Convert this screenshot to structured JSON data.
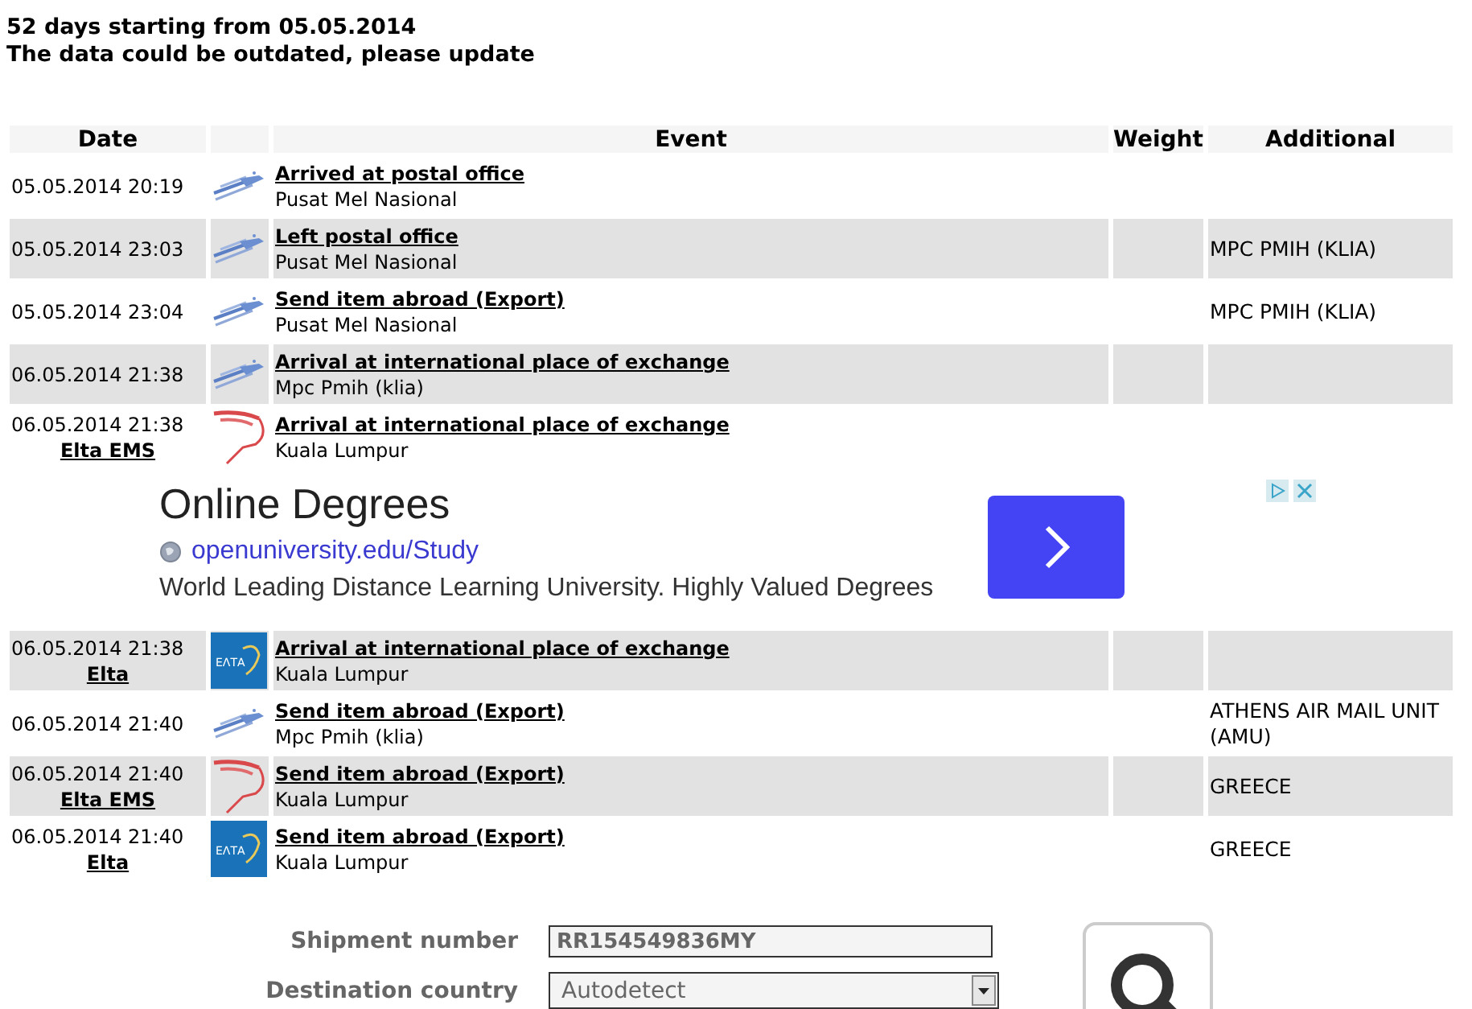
{
  "header": {
    "lines": [
      "52 days starting from 05.05.2014",
      "The data could be outdated, please update"
    ]
  },
  "table": {
    "columns": [
      {
        "label": "Date"
      },
      {
        "label": "Event"
      },
      {
        "label": "Weight"
      },
      {
        "label": "Additional"
      }
    ],
    "rows": [
      {
        "kind": "post_event",
        "date": "05.05.2014 20:19",
        "event": "Arrived at postal office",
        "place": "Pusat Mel Nasional"
      },
      {
        "kind": "post_event",
        "date": "05.05.2014 23:03",
        "event": "Left postal office",
        "place": "Pusat Mel Nasional",
        "additional": "MPC PMIH (KLIA)"
      },
      {
        "kind": "post_event",
        "date": "05.05.2014 23:04",
        "event": "Send item abroad (Export)",
        "place": "Pusat Mel Nasional",
        "additional": "MPC PMIH (KLIA)"
      },
      {
        "kind": "post_event",
        "date": "06.05.2014 21:38",
        "event": "Arrival at international place of exchange",
        "place": "Mpc Pmih (klia)"
      },
      {
        "kind": "ems_event",
        "date": "06.05.2014 21:38",
        "carrier": "Elta EMS",
        "event": "Arrival at international place of exchange",
        "place": "Kuala Lumpur"
      },
      {
        "kind": "ad",
        "title": "Online Degrees",
        "url": "openuniversity.edu/Study",
        "description": "World Leading Distance Learning University. Highly Valued Degrees"
      },
      {
        "kind": "elta_event",
        "date": "06.05.2014 21:38",
        "carrier": "Elta",
        "logo_text": "ΕΛΤΑ",
        "event": "Arrival at international place of exchange",
        "place": "Kuala Lumpur"
      },
      {
        "kind": "post_event",
        "date": "06.05.2014 21:40",
        "event": "Send item abroad (Export)",
        "place": "Mpc Pmih (klia)",
        "additional": "ATHENS AIR MAIL UNIT (AMU)"
      },
      {
        "kind": "ems_event",
        "date": "06.05.2014 21:40",
        "carrier": "Elta EMS",
        "event": "Send item abroad (Export)",
        "place": "Kuala Lumpur",
        "additional": "GREECE"
      },
      {
        "kind": "elta_event",
        "date": "06.05.2014 21:40",
        "carrier": "Elta",
        "logo_text": "ΕΛΤΑ",
        "event": "Send item abroad (Export)",
        "place": "Kuala Lumpur",
        "additional": "GREECE"
      }
    ]
  },
  "form": {
    "fields": [
      {
        "kind": "text",
        "label": "Shipment number",
        "value": "RR154549836MY"
      },
      {
        "kind": "select",
        "label": "Destination country",
        "value": "Autodetect"
      }
    ]
  }
}
